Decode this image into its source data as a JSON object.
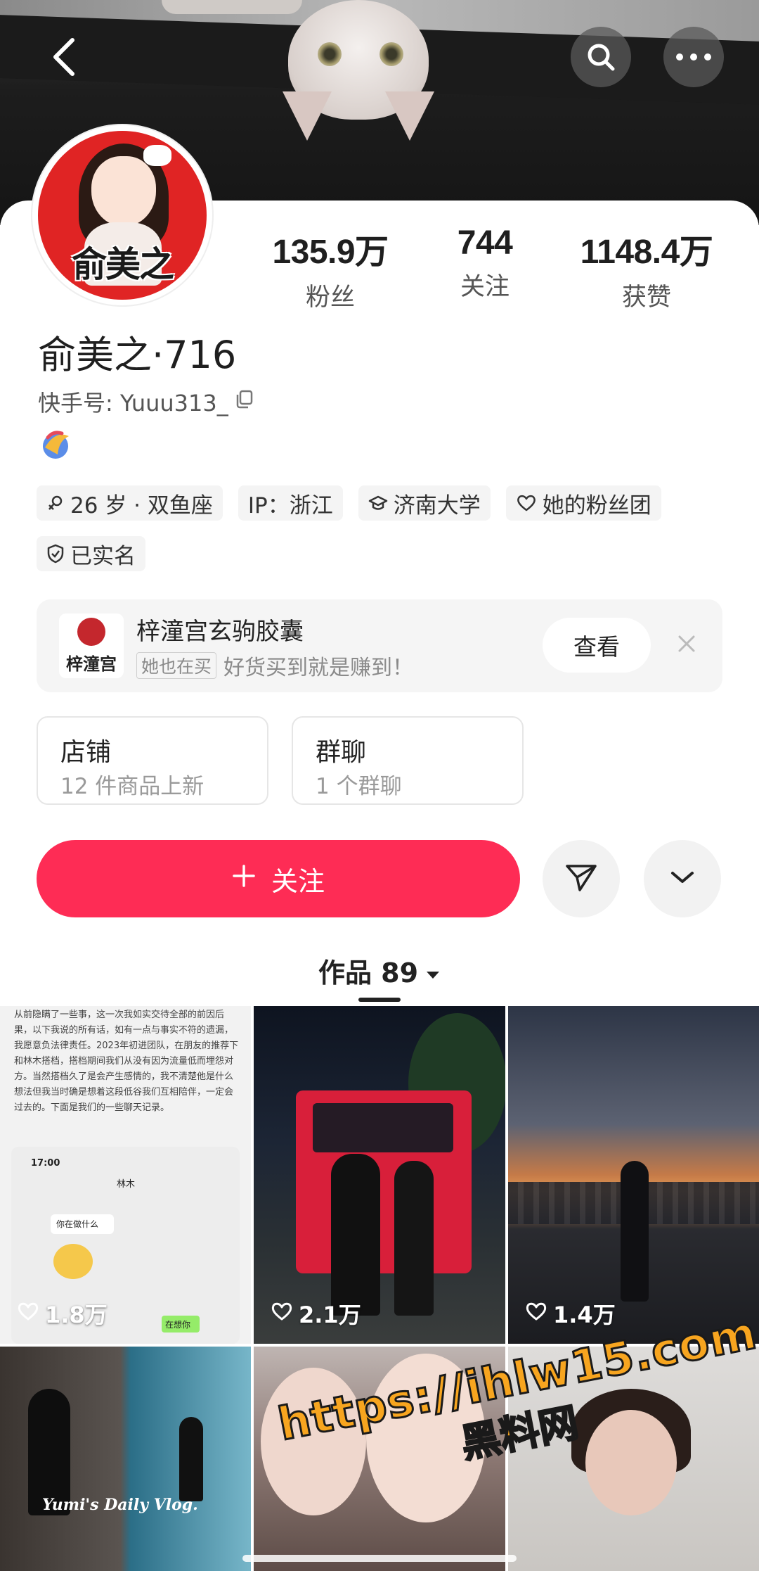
{
  "profile": {
    "nickname": "俞美之·716",
    "kuaishou_id": "快手号: Yuuu313_",
    "avatar_text": "俞美之"
  },
  "stats": [
    {
      "value": "135.9万",
      "label": "粉丝"
    },
    {
      "value": "744",
      "label": "关注"
    },
    {
      "value": "1148.4万",
      "label": "获赞"
    }
  ],
  "tags": [
    {
      "icon": "female-icon",
      "text": "26 岁 · 双鱼座"
    },
    {
      "icon": "",
      "text": "IP：浙江"
    },
    {
      "icon": "graduation-cap-icon",
      "text": "济南大学"
    },
    {
      "icon": "heart-icon",
      "text": "她的粉丝团"
    },
    {
      "icon": "verified-shield-icon",
      "text": "已实名"
    }
  ],
  "promo": {
    "title": "梓潼宫玄驹胶囊",
    "chip": "她也在买",
    "subtitle": "好货买到就是赚到！",
    "thumb_text": "梓潼宫",
    "view_label": "查看"
  },
  "boxes": {
    "shop": {
      "title": "店铺",
      "sub": "12 件商品上新"
    },
    "group": {
      "title": "群聊",
      "sub": "1 个群聊"
    }
  },
  "actions": {
    "follow_label": "关注"
  },
  "works": {
    "label": "作品 89"
  },
  "grid": {
    "tile1_likes": "1.8万",
    "tile2_likes": "2.1万",
    "tile3_likes": "1.4万",
    "tile1_essay": "从前隐瞒了一些事，这一次我如实交待全部的前因后果，以下我说的所有话，如有一点与事实不符的遗漏，我愿意负法律责任。2023年初进团队，在朋友的推荐下和林木搭档，搭档期间我们从没有因为流量低而埋怨对方。当然搭档久了是会产生感情的，我不清楚他是什么想法但我当时确是想着这段低谷我们互相陪伴，一定会过去的。下面是我们的一些聊天记录。",
    "tile1_chat_time": "17:00",
    "tile1_chat_name": "林木",
    "tile1_chat_msg": "你在做什么",
    "tile1_chat_reply": "在想你",
    "tile4_text": "Yumi's Daily Vlog."
  },
  "watermark": {
    "url": "https://ihlw15.com",
    "cn": "黑料网"
  },
  "colors": {
    "accent": "#fe2c55",
    "watermark": "#f7a51f"
  }
}
